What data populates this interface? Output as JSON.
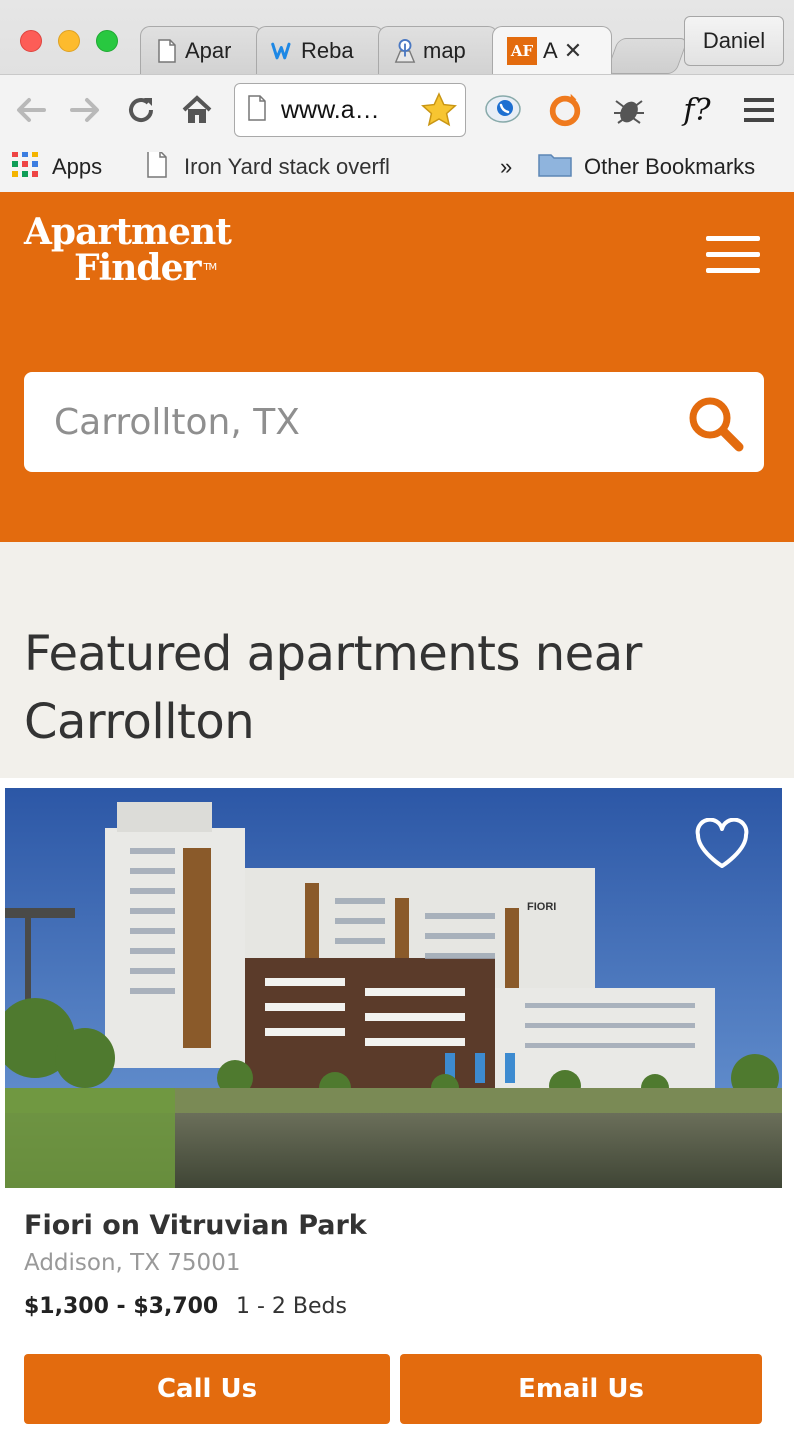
{
  "browser": {
    "tabs": [
      {
        "label": "Apar",
        "icon": "page-icon"
      },
      {
        "label": "Reba",
        "icon": "weebly-icon"
      },
      {
        "label": "map",
        "icon": "maps-pin-icon"
      },
      {
        "label": "A",
        "icon": "af-favicon-icon",
        "favicon_text": "AF",
        "close": "✕"
      }
    ],
    "profile_label": "Daniel",
    "url": "www.a…",
    "bookmarks": {
      "apps_label": "Apps",
      "item1_label": "Iron Yard stack overfl",
      "overflow_label": "»",
      "other_label": "Other Bookmarks"
    },
    "extensions": {
      "fx_label": "f?"
    }
  },
  "site": {
    "logo_line1": "Apartment",
    "logo_line2": "Finder",
    "logo_tm": "TM",
    "search_value": "Carrollton, TX",
    "featured_title": "Featured apartments near Carrollton",
    "listing": {
      "photo_sign": "FIORI",
      "name": "Fiori on Vitruvian Park",
      "address": "Addison, TX 75001",
      "price": "$1,300 - $3,700",
      "beds": "1 - 2 Beds",
      "call_label": "Call Us",
      "email_label": "Email Us"
    }
  },
  "colors": {
    "brand_orange": "#e36b0e",
    "featured_bg": "#f2f0eb",
    "title_text": "#333333",
    "address_text": "#999999"
  }
}
